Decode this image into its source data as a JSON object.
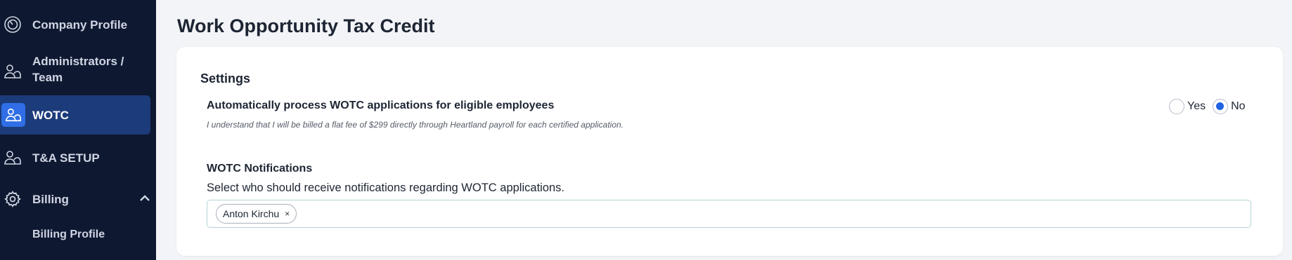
{
  "sidebar": {
    "items": [
      {
        "label": "Company Profile",
        "icon": "speedometer-icon"
      },
      {
        "label": "Administrators / Team",
        "label_line1": "Administrators /",
        "label_line2": "Team",
        "icon": "users-icon"
      },
      {
        "label": "WOTC",
        "icon": "users-icon",
        "active": true
      },
      {
        "label": "T&A SETUP",
        "icon": "users-icon"
      },
      {
        "label": "Billing",
        "icon": "gear-icon",
        "expanded": true
      }
    ],
    "sub_items": [
      {
        "label": "Billing Profile"
      }
    ]
  },
  "page": {
    "title": "Work Opportunity Tax Credit"
  },
  "settings": {
    "heading": "Settings",
    "auto_process": {
      "title": "Automatically process WOTC applications for eligible employees",
      "description": "I understand that I will be billed a flat fee of $299 directly through Heartland payroll for each certified application.",
      "options": [
        {
          "label": "Yes",
          "checked": false
        },
        {
          "label": "No",
          "checked": true
        }
      ]
    },
    "notifications": {
      "title": "WOTC Notifications",
      "description": "Select who should receive notifications regarding WOTC applications.",
      "selected": [
        {
          "name": "Anton Kirchu",
          "remove": "×"
        }
      ]
    }
  },
  "colors": {
    "sidebar_bg": "#0f1831",
    "active_bg": "#1c3b7a",
    "accent": "#1f63e0",
    "page_bg": "#f3f4f7"
  }
}
